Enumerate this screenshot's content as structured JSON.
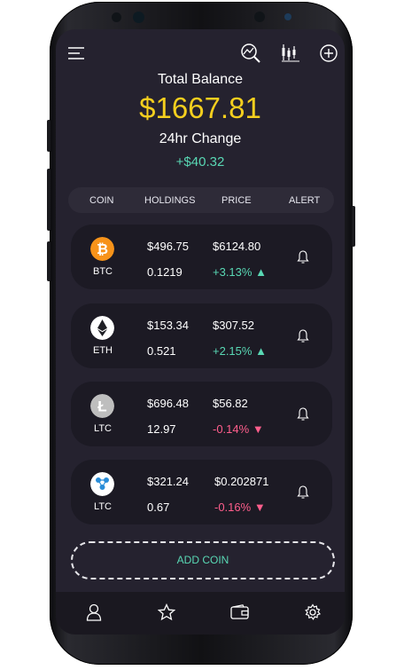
{
  "header": {
    "menu_icon": "hamburger-menu-icon",
    "action_icons": [
      "chart-search-icon",
      "candlestick-chart-icon",
      "add-circle-icon"
    ],
    "total_balance_label": "Total Balance",
    "total_balance_value": "$1667.81",
    "change_label": "24hr Change",
    "change_value": "+$40.32"
  },
  "columns": [
    "COIN",
    "HOLDINGS",
    "PRICE",
    "ALERT"
  ],
  "coins": [
    {
      "symbol": "BTC",
      "icon": "bitcoin-icon",
      "holding_value": "$496.75",
      "holding_amount": "0.1219",
      "price": "$6124.80",
      "change": "+3.13%",
      "direction": "up",
      "color": "#f7931a"
    },
    {
      "symbol": "ETH",
      "icon": "ethereum-icon",
      "holding_value": "$153.34",
      "holding_amount": "0.521",
      "price": "$307.52",
      "change": "+2.15%",
      "direction": "up",
      "color": "#ffffff"
    },
    {
      "symbol": "LTC",
      "icon": "litecoin-icon",
      "holding_value": "$696.48",
      "holding_amount": "12.97",
      "price": "$56.82",
      "change": "-0.14%",
      "direction": "down",
      "color": "#bebebe"
    },
    {
      "symbol": "LTC",
      "icon": "ripple-icon",
      "holding_value": "$321.24",
      "holding_amount": "0.67",
      "price": "$0.202871",
      "change": "-0.16%",
      "direction": "down",
      "color": "#ffffff"
    }
  ],
  "add_coin_label": "ADD COIN",
  "bottom_nav": [
    "profile-icon",
    "favorites-star-icon",
    "wallet-icon",
    "settings-gear-icon"
  ],
  "colors": {
    "accent_gold": "#f5cf1e",
    "positive": "#59d8b4",
    "negative": "#ff5e8c",
    "screen_bg": "#25222f",
    "card_bg": "#1c1a24"
  }
}
